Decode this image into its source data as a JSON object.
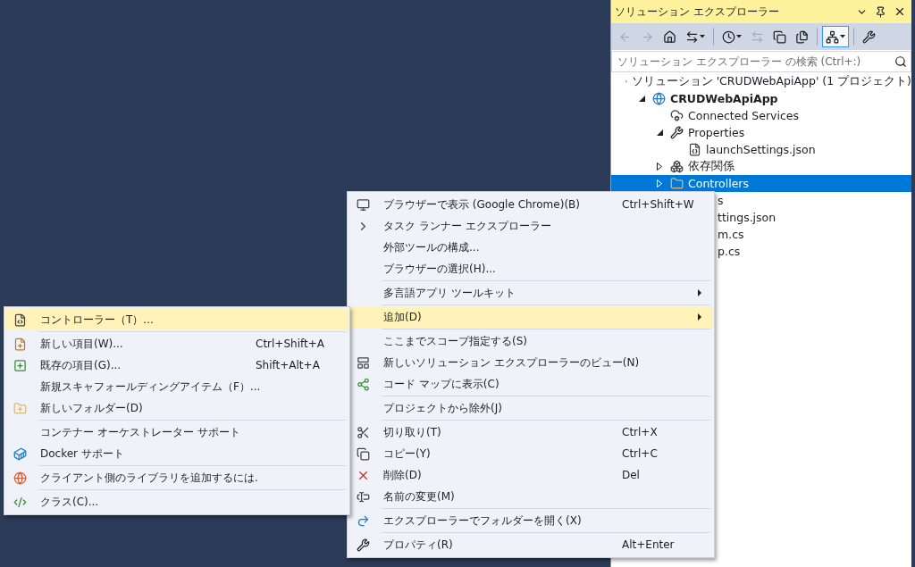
{
  "panel": {
    "title": "ソリューション エクスプローラー",
    "toolbar": [
      [
        {
          "disabled": true,
          "pressed": false,
          "dropdown": false
        },
        {
          "disabled": true,
          "pressed": false,
          "dropdown": false
        },
        {
          "disabled": false,
          "pressed": false,
          "dropdown": false
        },
        {
          "disabled": false,
          "pressed": false,
          "dropdown": true
        }
      ],
      [
        {
          "disabled": false,
          "pressed": false,
          "dropdown": true
        },
        {
          "disabled": true,
          "pressed": false,
          "dropdown": false
        },
        {
          "disabled": false,
          "pressed": false,
          "dropdown": false
        },
        {
          "disabled": false,
          "pressed": false,
          "dropdown": false
        }
      ],
      [
        {
          "disabled": false,
          "pressed": true,
          "dropdown": true
        }
      ],
      [
        {
          "disabled": false,
          "pressed": false,
          "dropdown": false
        }
      ]
    ],
    "search": {
      "placeholder": "ソリューション エクスプローラー の検索 (Ctrl+:)"
    },
    "tree": [
      {
        "kind": "solution",
        "label": "ソリューション 'CRUDWebApiApp' (1 プロジェクト)",
        "selected": false,
        "children": [
          {
            "kind": "project",
            "label": "CRUDWebApiApp",
            "expanded": true,
            "selected": false,
            "children": [
              {
                "kind": "service",
                "label": "Connected Services",
                "selected": false
              },
              {
                "kind": "properties",
                "label": "Properties",
                "expanded": true,
                "selected": false,
                "children": [
                  {
                    "kind": "json",
                    "label": "launchSettings.json",
                    "selected": false
                  }
                ]
              },
              {
                "kind": "dependencies",
                "label": "依存関係",
                "expanded": false,
                "selected": false
              },
              {
                "kind": "folder",
                "label": "Controllers",
                "expanded": false,
                "selected": true
              },
              {
                "kind": "partial",
                "label": "s",
                "selected": false
              },
              {
                "kind": "partial",
                "label": "ttings.json",
                "selected": false
              },
              {
                "kind": "partial",
                "label": "m.cs",
                "selected": false
              },
              {
                "kind": "partial",
                "label": "p.cs",
                "selected": false
              }
            ]
          }
        ]
      }
    ]
  },
  "context_menu": {
    "groups": [
      {
        "items": [
          {
            "label": "ブラウザーで表示 (Google Chrome)(B)",
            "shortcut": "Ctrl+Shift+W",
            "submenu": false,
            "selected": false
          },
          {
            "label": "タスク ランナー エクスプローラー",
            "submenu": false,
            "selected": false
          },
          {
            "label": "外部ツールの構成...",
            "submenu": false,
            "selected": false
          },
          {
            "label": "ブラウザーの選択(H)...",
            "submenu": false,
            "selected": false
          }
        ]
      },
      {
        "items": [
          {
            "label": "多言語アプリ ツールキット",
            "submenu": true,
            "selected": false
          }
        ]
      },
      {
        "items": [
          {
            "label": "追加(D)",
            "submenu": true,
            "selected": true
          }
        ]
      },
      {
        "items": [
          {
            "label": "ここまでスコープ指定する(S)",
            "submenu": false,
            "selected": false
          },
          {
            "label": "新しいソリューション エクスプローラーのビュー(N)",
            "submenu": false,
            "selected": false
          },
          {
            "label": "コード マップに表示(C)",
            "submenu": false,
            "selected": false
          }
        ]
      },
      {
        "items": [
          {
            "label": "プロジェクトから除外(J)",
            "submenu": false,
            "selected": false
          }
        ]
      },
      {
        "items": [
          {
            "label": "切り取り(T)",
            "shortcut": "Ctrl+X",
            "submenu": false,
            "selected": false
          },
          {
            "label": "コピー(Y)",
            "shortcut": "Ctrl+C",
            "submenu": false,
            "selected": false
          },
          {
            "label": "削除(D)",
            "shortcut": "Del",
            "submenu": false,
            "selected": false
          },
          {
            "label": "名前の変更(M)",
            "submenu": false,
            "selected": false
          }
        ]
      },
      {
        "items": [
          {
            "label": "エクスプローラーでフォルダーを開く(X)",
            "submenu": false,
            "selected": false
          }
        ]
      },
      {
        "items": [
          {
            "label": "プロパティ(R)",
            "shortcut": "Alt+Enter",
            "submenu": false,
            "selected": false
          }
        ]
      }
    ]
  },
  "submenu": {
    "groups": [
      {
        "items": [
          {
            "label": "コントローラー（T）...",
            "submenu": false,
            "selected": true
          }
        ]
      },
      {
        "items": [
          {
            "label": "新しい項目(W)...",
            "shortcut": "Ctrl+Shift+A",
            "submenu": false,
            "selected": false
          },
          {
            "label": "既存の項目(G)...",
            "shortcut": "Shift+Alt+A",
            "submenu": false,
            "selected": false
          },
          {
            "label": "新規スキャフォールディングアイテム（F）...",
            "submenu": false,
            "selected": false
          },
          {
            "label": "新しいフォルダー(D)",
            "submenu": false,
            "selected": false
          }
        ]
      },
      {
        "items": [
          {
            "label": "コンテナー オーケストレーター サポート",
            "submenu": false,
            "selected": false
          },
          {
            "label": "Docker サポート",
            "submenu": false,
            "selected": false
          }
        ]
      },
      {
        "items": [
          {
            "label": "クライアント側のライブラリを追加するには.",
            "submenu": false,
            "selected": false
          }
        ]
      },
      {
        "items": [
          {
            "label": "クラス(C)...",
            "submenu": false,
            "selected": false
          }
        ]
      }
    ]
  }
}
